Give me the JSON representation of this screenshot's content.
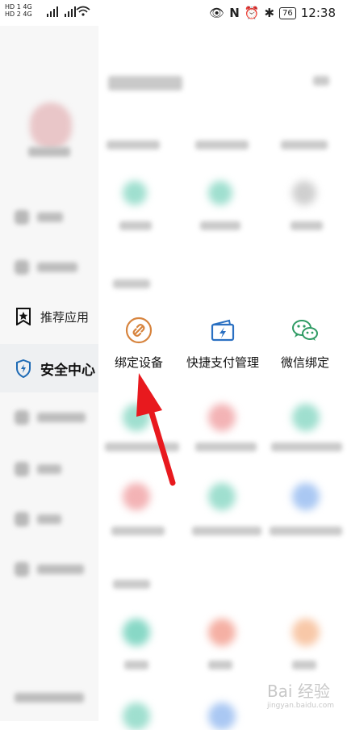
{
  "status_bar": {
    "left_line1": "HD 1  4G",
    "left_line2": "HD 2  4G",
    "battery": "76",
    "time": "12:38",
    "icons": [
      "eye-icon",
      "nfc-icon",
      "alarm-icon",
      "bluetooth-icon"
    ]
  },
  "sidebar": {
    "items": [
      {
        "label": "推荐应用",
        "icon": "star-bookmark-icon"
      },
      {
        "label": "安全中心",
        "icon": "shield-lightning-icon"
      }
    ]
  },
  "features": {
    "items": [
      {
        "label": "绑定设备",
        "icon": "link-icon",
        "color": "#d7843e"
      },
      {
        "label": "快捷支付管理",
        "icon": "card-lightning-icon",
        "color": "#2a70c2"
      },
      {
        "label": "微信绑定",
        "icon": "wechat-icon",
        "color": "#2f9b64"
      }
    ]
  },
  "watermark": {
    "text": "Bai 经验",
    "sub": "jingyan.baidu.com"
  },
  "colors": {
    "arrow": "#e8191e",
    "active_bg": "#eef0f2",
    "shield": "#1f6bb5"
  }
}
